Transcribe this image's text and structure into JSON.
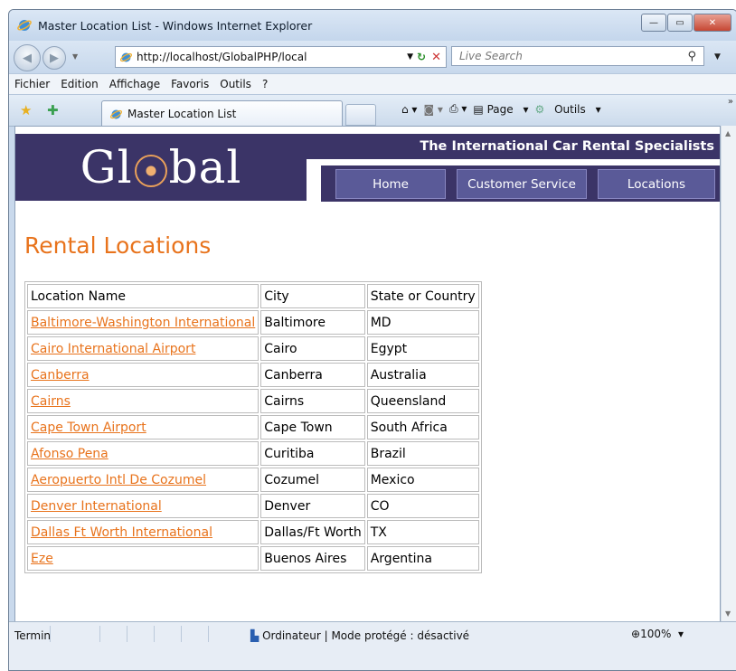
{
  "window": {
    "title": "Master Location List - Windows Internet Explorer"
  },
  "address": {
    "url": "http://localhost/GlobalPHP/local"
  },
  "search": {
    "placeholder": "Live Search"
  },
  "menu": [
    "Fichier",
    "Edition",
    "Affichage",
    "Favoris",
    "Outils",
    "?"
  ],
  "tab": {
    "label": "Master Location List"
  },
  "commands": {
    "page": "Page",
    "tools": "Outils"
  },
  "site": {
    "logo_left": "Gl",
    "logo_right": "bal",
    "tagline": "The International Car Rental Specialists",
    "nav": [
      "Home",
      "Customer Service",
      "Locations"
    ]
  },
  "page": {
    "heading": "Rental Locations"
  },
  "table": {
    "headers": [
      "Location Name",
      "City",
      "State or Country"
    ],
    "rows": [
      [
        "Baltimore-Washington International",
        "Baltimore",
        "MD"
      ],
      [
        "Cairo International Airport",
        "Cairo",
        "Egypt"
      ],
      [
        "Canberra",
        "Canberra",
        "Australia"
      ],
      [
        "Cairns",
        "Cairns",
        "Queensland"
      ],
      [
        "Cape Town Airport",
        "Cape Town",
        "South Africa"
      ],
      [
        "Afonso Pena",
        "Curitiba",
        "Brazil"
      ],
      [
        "Aeropuerto Intl De Cozumel",
        "Cozumel",
        "Mexico"
      ],
      [
        "Denver International",
        "Denver",
        "CO"
      ],
      [
        "Dallas Ft Worth International",
        "Dallas/Ft Worth",
        "TX"
      ],
      [
        "Eze",
        "Buenos Aires",
        "Argentina"
      ]
    ]
  },
  "status": {
    "left": "Termin",
    "zone": "Ordinateur | Mode protégé : désactivé",
    "zoom": "100%"
  },
  "colors": {
    "accent": "#e8731c",
    "brand": "#3b3467",
    "nav": "#5a5a98"
  }
}
